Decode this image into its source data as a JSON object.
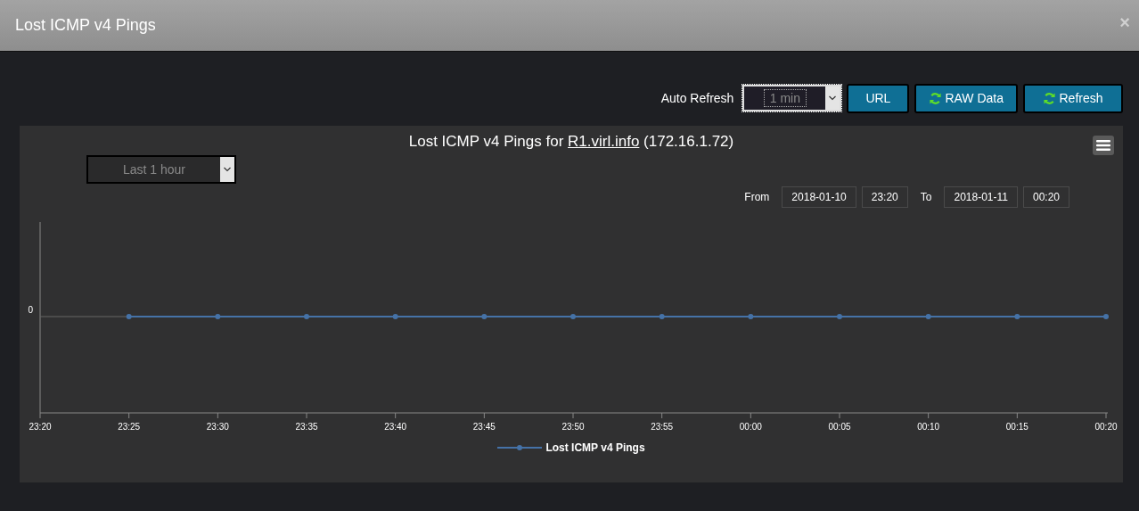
{
  "window": {
    "title": "Lost ICMP v4 Pings",
    "close": "×"
  },
  "toolbar": {
    "auto_refresh_label": "Auto Refresh",
    "auto_refresh_value": "1 min",
    "buttons": [
      {
        "label": "URL",
        "icon": false
      },
      {
        "label": "RAW Data",
        "icon": true
      },
      {
        "label": "Refresh",
        "icon": true
      }
    ]
  },
  "chart": {
    "title_prefix": "Lost ICMP v4 Pings for",
    "title_link": "R1.virl.info",
    "title_suffix": "(172.16.1.72)",
    "range": "Last 1 hour",
    "from_label": "From",
    "from_date": "2018-01-10",
    "from_time": "23:20",
    "to_label": "To",
    "to_date": "2018-01-11",
    "to_time": "00:20",
    "y_tick_label": "0",
    "x_tick_labels": [
      "23:20",
      "23:25",
      "23:30",
      "23:35",
      "23:40",
      "23:45",
      "23:50",
      "23:55",
      "00:00",
      "00:05",
      "00:10",
      "00:15",
      "00:20"
    ],
    "legend": "Lost ICMP v4 Pings"
  }
}
